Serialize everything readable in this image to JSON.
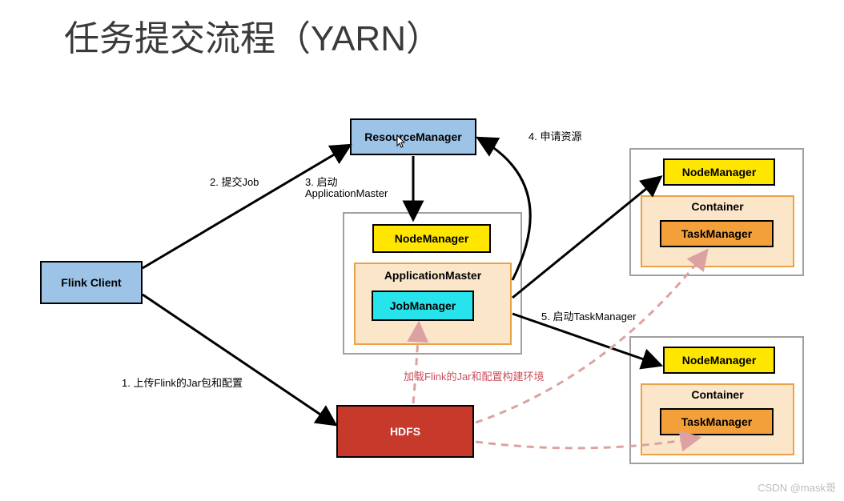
{
  "title": "任务提交流程（YARN）",
  "boxes": {
    "flinkClient": "Flink Client",
    "resourceManager": "ResourceManager",
    "hdfs": "HDFS",
    "nodeManager_main": "NodeManager",
    "applicationMaster": "ApplicationMaster",
    "jobManager": "JobManager",
    "nodeManager_top": "NodeManager",
    "container_top": "Container",
    "taskManager_top": "TaskManager",
    "nodeManager_bot": "NodeManager",
    "container_bot": "Container",
    "taskManager_bot": "TaskManager"
  },
  "labels": {
    "step1": "1. 上传Flink的Jar包和配置",
    "step2": "2. 提交Job",
    "step3a": "3. 启动",
    "step3b": "ApplicationMaster",
    "step4": "4. 申请资源",
    "step5": "5. 启动TaskManager",
    "load": "加载Flink的Jar和配置构建环境"
  },
  "watermark": "CSDN @mask哥"
}
